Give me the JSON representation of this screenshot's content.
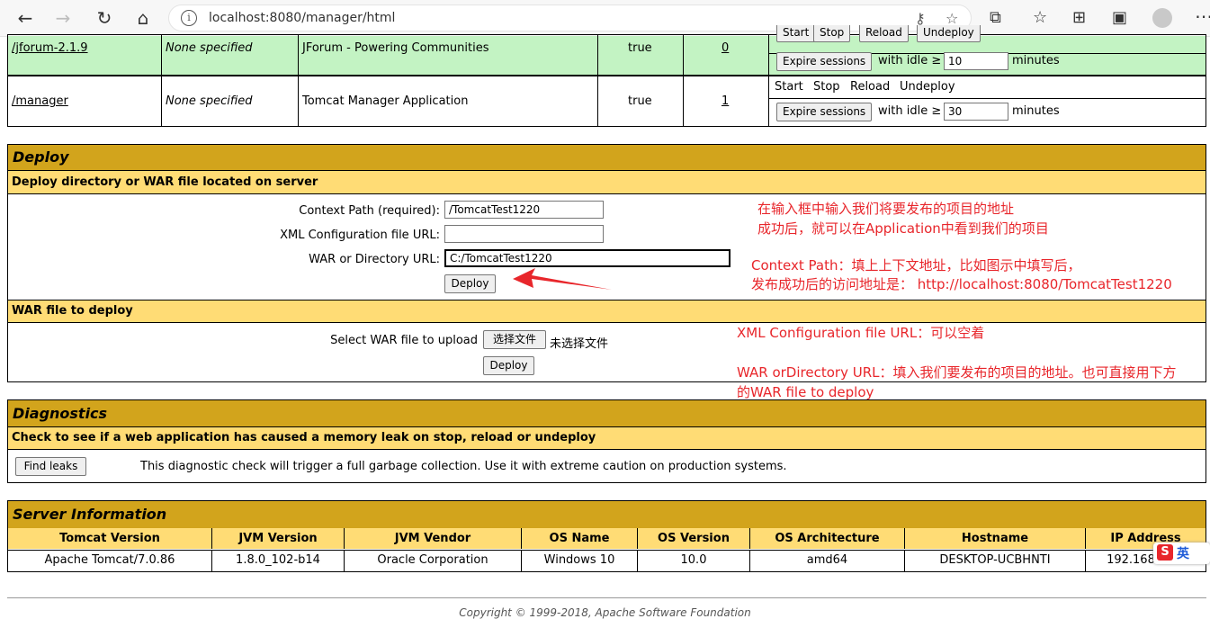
{
  "browser": {
    "url": "localhost:8080/manager/html",
    "back_icon": "←",
    "forward_icon": "→",
    "reload_icon": "↻",
    "home_icon": "⌂"
  },
  "apps": [
    {
      "path": "/jforum-2.1.9",
      "version": "None specified",
      "display_name": "JForum - Powering Communities",
      "running": "true",
      "sessions": "0",
      "commands": [
        "Start",
        "Stop",
        "Reload",
        "Undeploy"
      ],
      "expire_label": "Expire sessions",
      "with_idle": "with idle ≥",
      "idle_value": "10",
      "minutes": "minutes"
    },
    {
      "path": "/manager",
      "version": "None specified",
      "display_name": "Tomcat Manager Application",
      "running": "true",
      "sessions": "1",
      "commands": [
        "Start",
        "Stop",
        "Reload",
        "Undeploy"
      ],
      "expire_label": "Expire sessions",
      "with_idle": "with idle ≥",
      "idle_value": "30",
      "minutes": "minutes"
    }
  ],
  "deploy": {
    "title": "Deploy",
    "subtitle": "Deploy directory or WAR file located on server",
    "context_path_label": "Context Path (required):",
    "context_path_value": "/TomcatTest1220",
    "xml_label": "XML Configuration file URL:",
    "xml_value": "",
    "war_label": "WAR or Directory URL:",
    "war_value": "C:/TomcatTest1220",
    "deploy_button": "Deploy",
    "war_section_title": "WAR file to deploy",
    "select_war_label": "Select WAR file to upload",
    "choose_file_button": "选择文件",
    "no_file_chosen": "未选择文件",
    "war_deploy_button": "Deploy"
  },
  "annotations": {
    "line1": "在输入框中输入我们将要发布的项目的地址",
    "line2": "成功后，就可以在Application中看到我们的项目",
    "line3": "Context Path：填上上下文地址，比如图示中填写后，",
    "line4": "发布成功后的访问地址是：  http://localhost:8080/TomcatTest1220",
    "line5": "XML Configuration file URL：可以空着",
    "line6": "WAR orDirectory URL：填入我们要发布的项目的地址。也可直接用下方",
    "line7": "的WAR file to deploy"
  },
  "diagnostics": {
    "title": "Diagnostics",
    "subtitle": "Check to see if a web application has caused a memory leak on stop, reload or undeploy",
    "button": "Find leaks",
    "description": "This diagnostic check will trigger a full garbage collection. Use it with extreme caution on production systems."
  },
  "server_info": {
    "title": "Server Information",
    "headers": [
      "Tomcat Version",
      "JVM Version",
      "JVM Vendor",
      "OS Name",
      "OS Version",
      "OS Architecture",
      "Hostname",
      "IP Address"
    ],
    "values": [
      "Apache Tomcat/7.0.86",
      "1.8.0_102-b14",
      "Oracle Corporation",
      "Windows 10",
      "10.0",
      "amd64",
      "DESKTOP-UCBHNTI",
      "192.168.56.1"
    ]
  },
  "footer": {
    "copyright": "Copyright © 1999-2018, Apache Software Foundation"
  },
  "ime": {
    "logo": "S",
    "mode": "英"
  }
}
